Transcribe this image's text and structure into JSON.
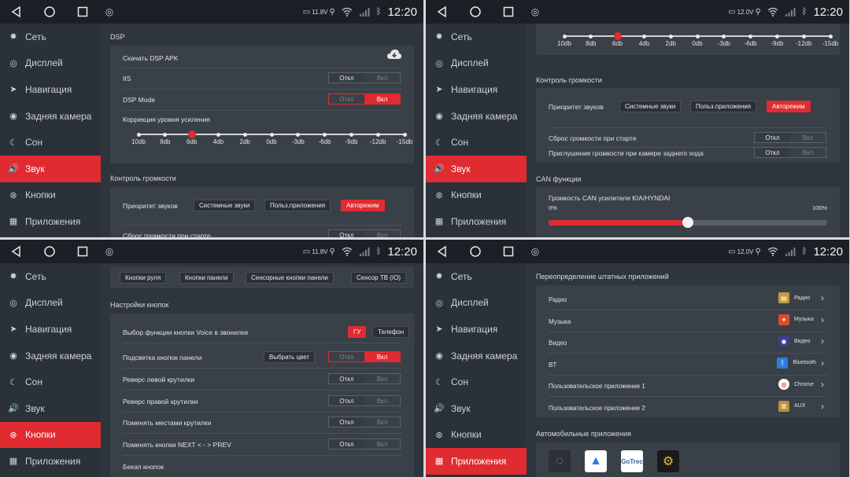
{
  "statusbar": {
    "time": "12:20",
    "voltages": [
      "11.8V",
      "12.0V",
      "11.8V",
      "12.0V"
    ]
  },
  "sidebar": {
    "items": [
      {
        "label": "Сеть",
        "icon": "gear-icon"
      },
      {
        "label": "Дисплей",
        "icon": "display-icon"
      },
      {
        "label": "Навигация",
        "icon": "navigation-arrow-icon"
      },
      {
        "label": "Задняя камера",
        "icon": "camera-icon"
      },
      {
        "label": "Сон",
        "icon": "moon-icon"
      },
      {
        "label": "Звук",
        "icon": "speaker-icon"
      },
      {
        "label": "Кнопки",
        "icon": "steering-wheel-icon"
      },
      {
        "label": "Приложения",
        "icon": "apps-grid-icon"
      }
    ],
    "active_indices": [
      5,
      5,
      6,
      7
    ]
  },
  "panel0": {
    "section_dsp": "DSP",
    "download_label": "Скачать DSP APK",
    "iis_label": "IIS",
    "dsp_mode_label": "DSP Mode",
    "gain_label": "Коррекция уровня усиления",
    "off": "Откл",
    "on": "Вкл",
    "ticks": [
      "10db",
      "8db",
      "6db",
      "4db",
      "2db",
      "0db",
      "-3db",
      "-6db",
      "-9db",
      "-12db",
      "-15db"
    ],
    "selected_tick": 2,
    "section_volume": "Контроль громкости",
    "priority_label": "Приоритет звуков",
    "priority_options": [
      "Системные звуки",
      "Польз.приложения",
      "Авторежим"
    ],
    "priority_selected": 2,
    "reset_label": "Сброс громкости при старте"
  },
  "panel1": {
    "gain_label_clipped": "Коррекция уровня усиления",
    "ticks": [
      "10db",
      "8db",
      "6db",
      "4db",
      "2db",
      "0db",
      "-3db",
      "-6db",
      "-9db",
      "-12db",
      "-15db"
    ],
    "selected_tick": 2,
    "section_volume": "Контроль громкости",
    "priority_label": "Приоритет звуков",
    "priority_options": [
      "Системные звуки",
      "Польз.приложения",
      "Авторежим"
    ],
    "priority_selected": 2,
    "reset_label": "Сброс громкости при старте",
    "mute_label": "Приглушение громкости при камере заднего хода",
    "off": "Откл",
    "on": "Вкл",
    "section_can": "CAN функции",
    "can_label": "Громкость CAN усилителя KIA/HYNDAI",
    "can_min": "0%",
    "can_max": "100%",
    "can_value": 0.5
  },
  "panel2": {
    "tabs": [
      "Кнопки руля",
      "Кнопки панели",
      "Сенсорные кнопки панели",
      "Сенсор ТВ (IO)"
    ],
    "section_buttons": "Настройки кнопок",
    "voice_label": "Выбор функции кнопки Voice в звонилке",
    "voice_opt_a": "ГУ",
    "voice_opt_b": "Телефон",
    "backlight_label": "Подсветка кнопок панели",
    "choose_color": "Выбрать цвет",
    "rev_left": "Реверс левой крутилки",
    "rev_right": "Реверс правой крутилки",
    "swap_knobs": "Поменять местами крутилки",
    "swap_next": "Поменять кнопки NEXT < - > PREV",
    "backup": "Бекап кнопок",
    "off": "Откл",
    "on": "Вкл"
  },
  "panel3": {
    "section_override": "Переопределение штатных приложений",
    "rows": [
      {
        "label": "Радио",
        "app": "Радио",
        "icon": "radio-icon",
        "color": "#c89a3c"
      },
      {
        "label": "Музыка",
        "app": "Музыка",
        "icon": "music-icon",
        "color": "#e24a2a"
      },
      {
        "label": "Видео",
        "app": "Видео",
        "icon": "video-icon",
        "color": "#3b3f8a"
      },
      {
        "label": "BT",
        "app": "Bluetooth",
        "icon": "bluetooth-icon",
        "color": "#2a7de1"
      },
      {
        "label": "Пользовательское приложение 1",
        "app": "Chrome",
        "icon": "chrome-icon",
        "color": "#ffffff"
      },
      {
        "label": "Пользовательское приложение 2",
        "app": "AUX",
        "icon": "aux-icon",
        "color": "#b8903a"
      }
    ],
    "section_car": "Автомобильные приложения",
    "car_apps": [
      {
        "icon": "tire-pressure-icon",
        "color": "#d9822b"
      },
      {
        "icon": "navigation-app-icon",
        "color": "#ffffff"
      },
      {
        "icon": "gotrec-icon",
        "color": "#ffffff",
        "text": "GoTrec"
      },
      {
        "icon": "car-diagnostic-icon",
        "color": "#e8b93a"
      }
    ]
  },
  "colors": {
    "accent": "#e02b31",
    "background": "#2f353c"
  }
}
